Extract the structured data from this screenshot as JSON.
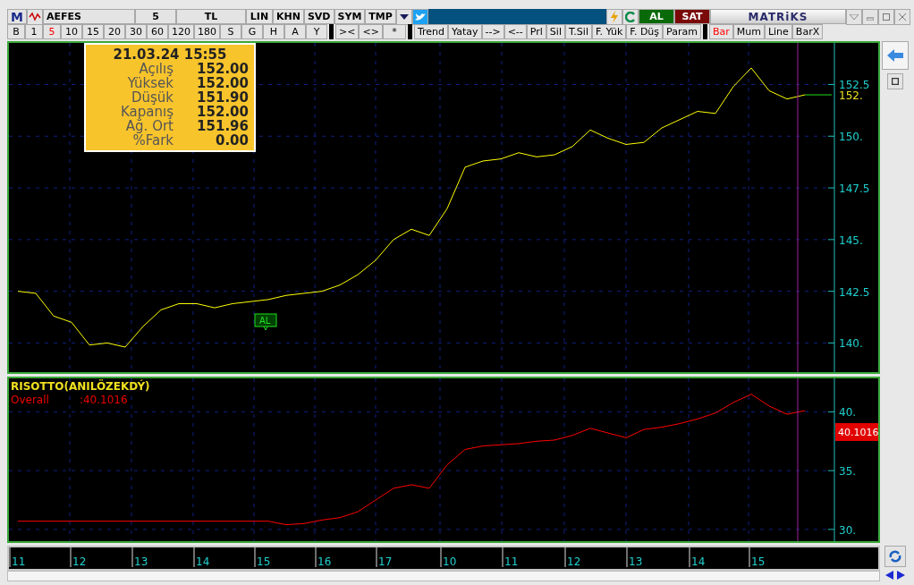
{
  "toolbar": {
    "logo": "M",
    "symbol": "AEFES",
    "period": "5",
    "currency": "TL",
    "buttons": [
      "LIN",
      "KHN",
      "SVD",
      "SYM",
      "TMP"
    ],
    "buy": "AL",
    "sell": "SAT",
    "brand": "MATRiKS"
  },
  "periods": [
    {
      "label": "B",
      "selected": false
    },
    {
      "label": "1",
      "selected": false
    },
    {
      "label": "5",
      "selected": true
    },
    {
      "label": "10",
      "selected": false
    },
    {
      "label": "15",
      "selected": false
    },
    {
      "label": "20",
      "selected": false
    },
    {
      "label": "30",
      "selected": false
    },
    {
      "label": "60",
      "selected": false
    },
    {
      "label": "120",
      "selected": false
    },
    {
      "label": "180",
      "selected": false
    },
    {
      "label": "S",
      "selected": false
    },
    {
      "label": "G",
      "selected": false
    },
    {
      "label": "H",
      "selected": false
    },
    {
      "label": "A",
      "selected": false
    },
    {
      "label": "Y",
      "selected": false
    }
  ],
  "zoom_tools": [
    "><",
    "<>",
    "*"
  ],
  "drawing_tools": [
    "Trend",
    "Yatay",
    "-->",
    "<--",
    "Prl",
    "Sil",
    "T.Sil",
    "F. Yük",
    "F. Düş",
    "Param"
  ],
  "chart_styles": [
    {
      "label": "Bar",
      "selected": true
    },
    {
      "label": "Mum",
      "selected": false
    },
    {
      "label": "Line",
      "selected": false
    },
    {
      "label": "BarX",
      "selected": false
    }
  ],
  "info": {
    "datetime": "21.03.24 15:55",
    "rows": [
      {
        "label": "Açılış",
        "value": "152.00"
      },
      {
        "label": "Yüksek",
        "value": "152.00"
      },
      {
        "label": "Düşük",
        "value": "151.90"
      },
      {
        "label": "Kapanış",
        "value": "152.00"
      },
      {
        "label": "Ağ. Ort",
        "value": "151.96"
      },
      {
        "label": "%Fark",
        "value": "0.00"
      }
    ]
  },
  "price_panel": {
    "signal": "AL",
    "last_price": "152.",
    "chart_data": {
      "type": "line",
      "ylim": [
        138.59,
        154.51
      ],
      "yticks": [
        {
          "value": 140,
          "label": "140."
        },
        {
          "value": 142.5,
          "label": "142.5"
        },
        {
          "value": 145,
          "label": "145."
        },
        {
          "value": 147.5,
          "label": "147.5"
        },
        {
          "value": 150,
          "label": "150."
        },
        {
          "value": 152.5,
          "label": "152.5"
        }
      ],
      "grid": true,
      "series": [
        {
          "color": "#ffff00",
          "values": [
            142.5,
            142.4,
            141.3,
            141.0,
            139.9,
            140.0,
            139.8,
            140.8,
            141.6,
            141.9,
            141.9,
            141.7,
            141.9,
            142.0,
            142.1,
            142.3,
            142.4,
            142.5,
            142.8,
            143.3,
            144.0,
            145.0,
            145.5,
            145.2,
            146.5,
            148.5,
            148.8,
            148.9,
            149.2,
            149.0,
            149.1,
            149.5,
            150.3,
            149.9,
            149.6,
            149.7,
            150.4,
            150.8,
            151.2,
            151.1,
            152.4,
            153.3,
            152.2,
            151.8,
            152.0
          ]
        }
      ]
    }
  },
  "indicator_panel": {
    "title": "RISOTTO(ANILÖZEKDÝ)",
    "legend_value": ":40.1016",
    "value_label": "40.1016",
    "chart_data": {
      "type": "line",
      "ylim": [
        29.0,
        42.85
      ],
      "yticks": [
        {
          "value": 30,
          "label": "30."
        },
        {
          "value": 35,
          "label": "35."
        },
        {
          "value": 40,
          "label": "40."
        }
      ],
      "grid": true,
      "series": [
        {
          "name": "Overall",
          "color": "#ff0000",
          "values": [
            30.7,
            30.7,
            30.7,
            30.7,
            30.7,
            30.7,
            30.7,
            30.7,
            30.7,
            30.7,
            30.7,
            30.7,
            30.7,
            30.7,
            30.7,
            30.4,
            30.5,
            30.8,
            31.0,
            31.5,
            32.5,
            33.5,
            33.8,
            33.5,
            35.5,
            36.8,
            37.1,
            37.2,
            37.3,
            37.5,
            37.6,
            38.0,
            38.6,
            38.2,
            37.8,
            38.5,
            38.7,
            39.0,
            39.4,
            39.9,
            40.8,
            41.5,
            40.5,
            39.8,
            40.1
          ]
        }
      ]
    }
  },
  "time_axis": [
    "11",
    "12",
    "13",
    "14",
    "15",
    "16",
    "17",
    "10",
    "11",
    "12",
    "13",
    "14",
    "15"
  ]
}
